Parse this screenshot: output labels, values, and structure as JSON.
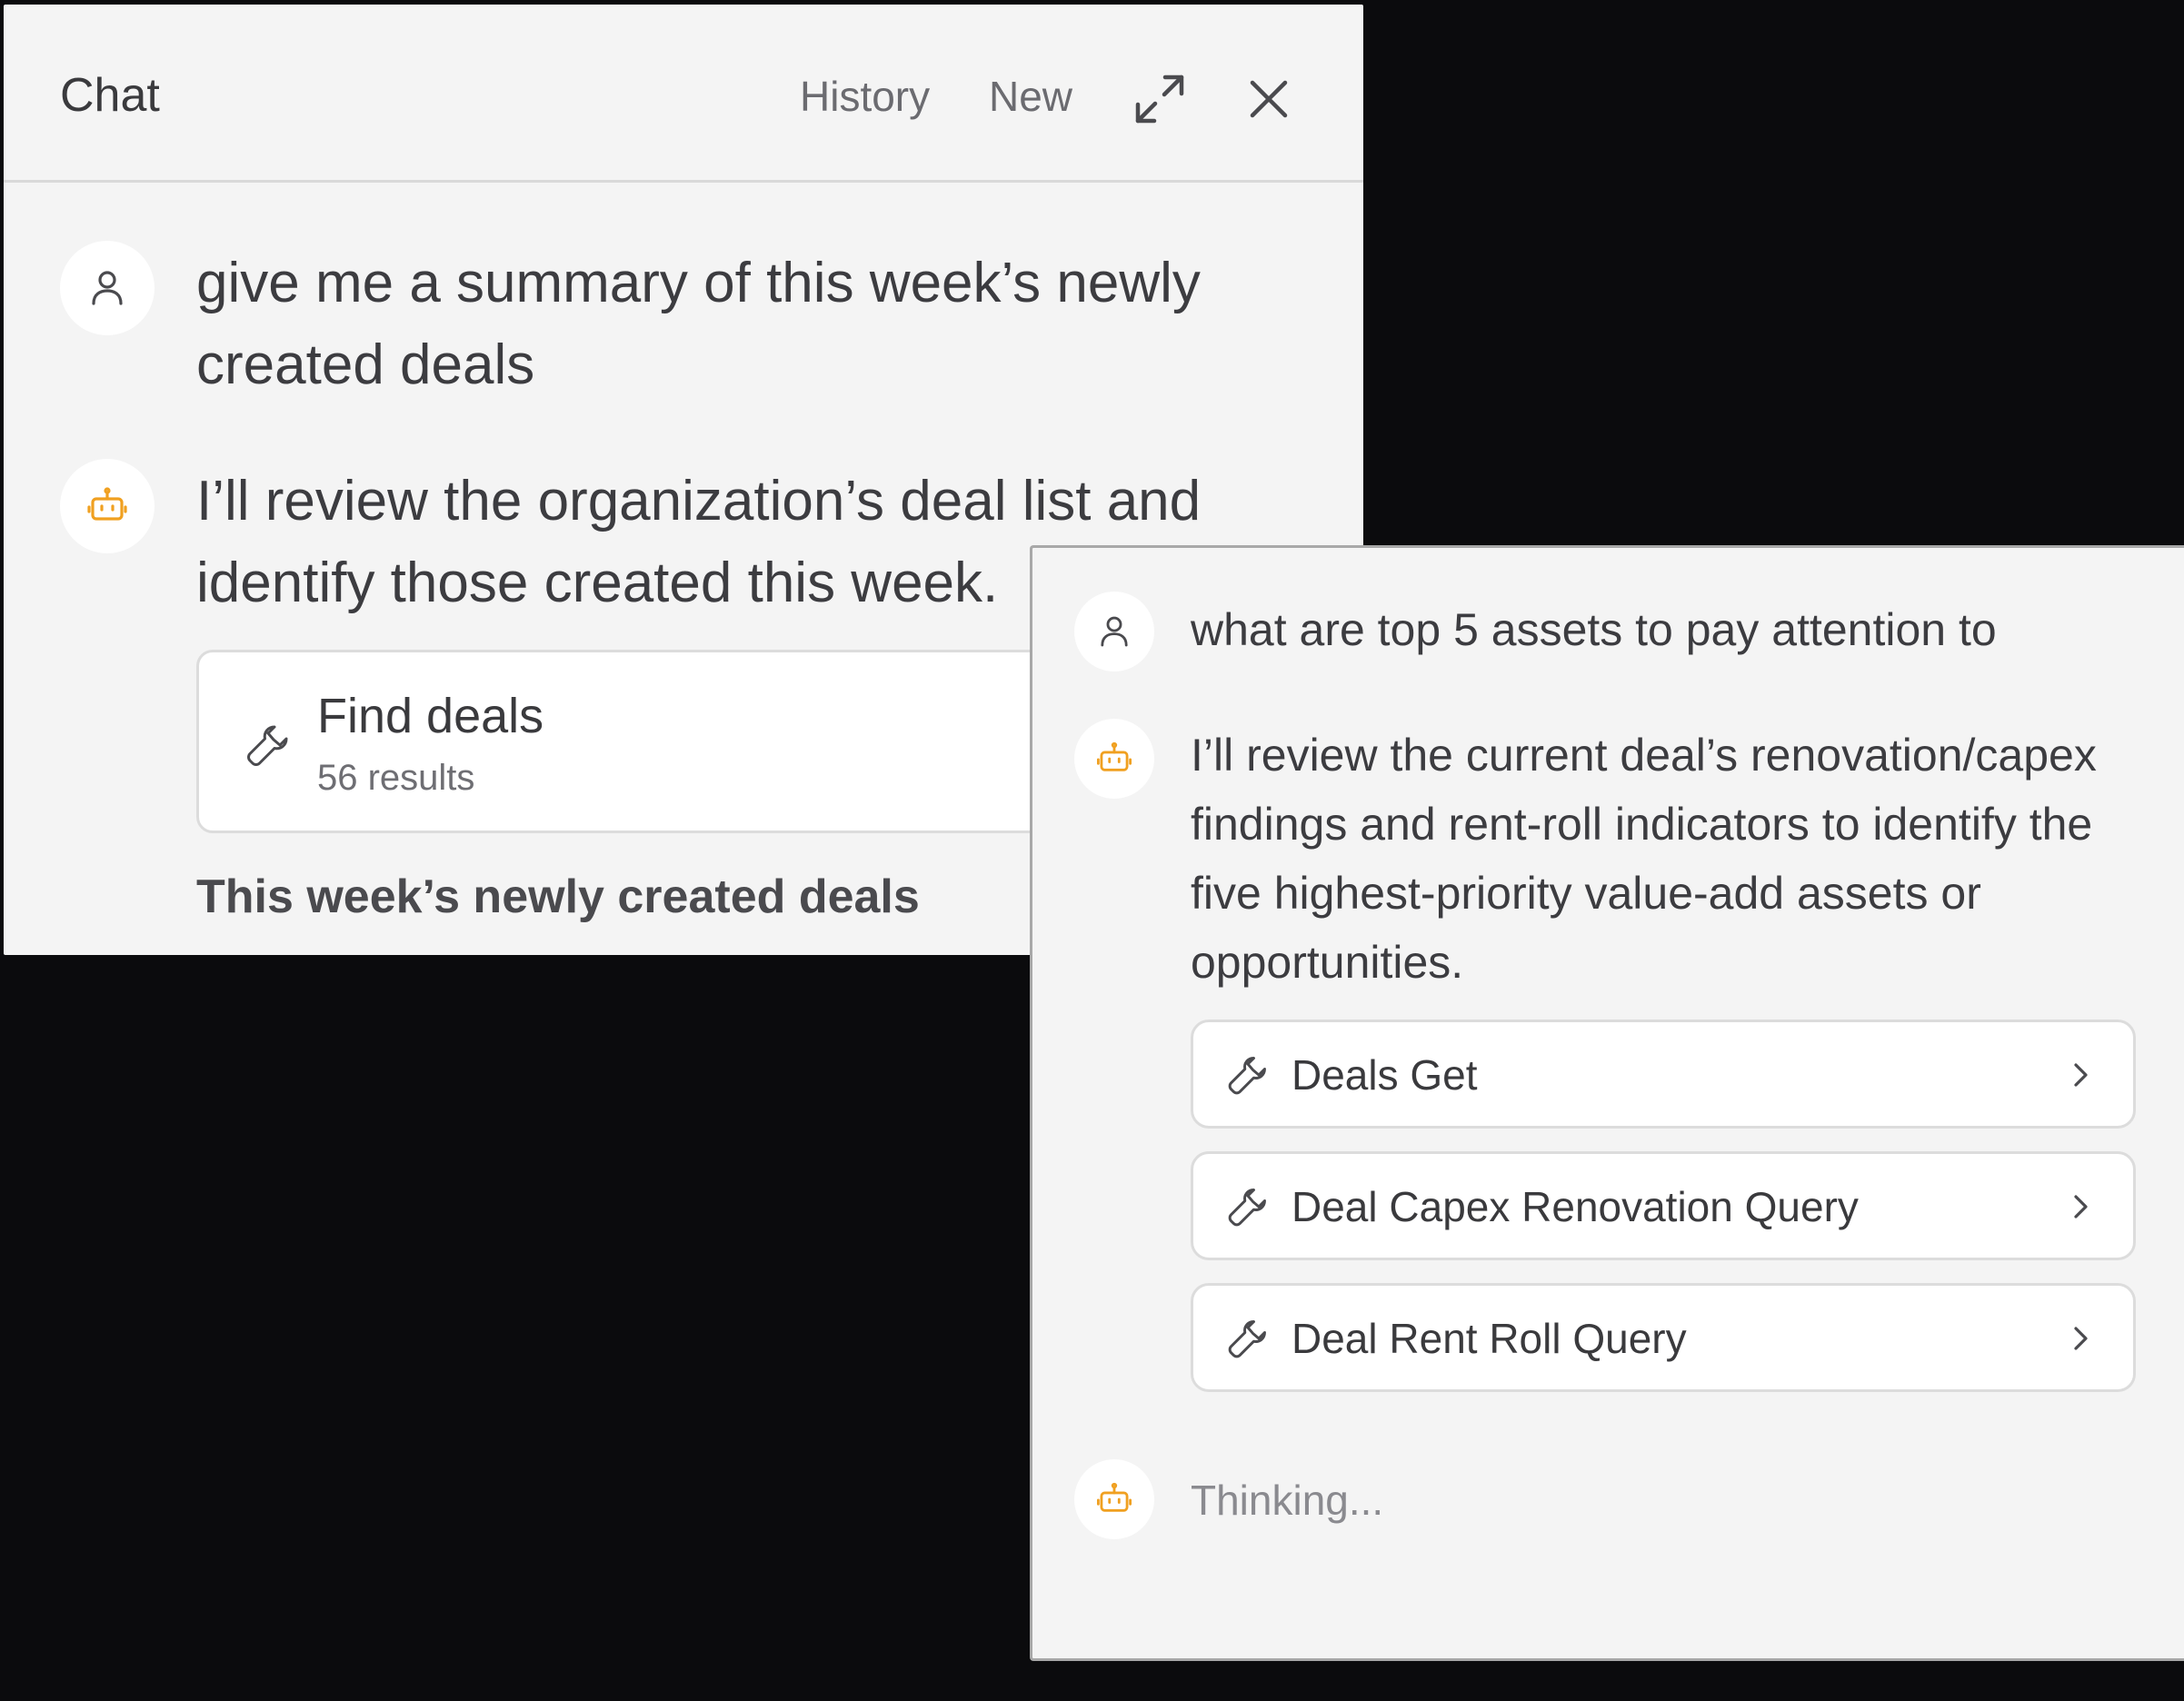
{
  "chat_panel": {
    "title": "Chat",
    "history_label": "History",
    "new_label": "New",
    "messages": [
      {
        "role": "user",
        "text": "give me a summary of this week’s newly created deals"
      },
      {
        "role": "assistant",
        "text": "I’ll review the organization’s deal list and identify those created this week."
      }
    ],
    "tool_card": {
      "name": "Find deals",
      "result": "56 results"
    },
    "section_heading": "This week’s newly created deals"
  },
  "overlay_panel": {
    "messages": [
      {
        "role": "user",
        "text": "what are top 5 assets to pay attention to"
      },
      {
        "role": "assistant",
        "text": "I’ll review the current deal’s renovation/capex findings and rent-roll indicators to identify the five highest-priority value-add assets or opportunities."
      }
    ],
    "tools": [
      {
        "label": "Deals Get"
      },
      {
        "label": "Deal Capex Renovation Query"
      },
      {
        "label": "Deal Rent Roll Query"
      }
    ],
    "thinking_text": "Thinking..."
  },
  "colors": {
    "page_background": "#0b0b0d",
    "panel_background": "#f4f4f4",
    "assistant_icon_accent": "#f0a020",
    "user_icon": "#4a4a4e"
  },
  "icons": {
    "user_avatar": "user-icon",
    "assistant_avatar": "robot-icon",
    "tool": "wrench-icon",
    "expand": "expand-icon",
    "close": "close-icon",
    "row_chevron": "chevron-right-icon"
  }
}
